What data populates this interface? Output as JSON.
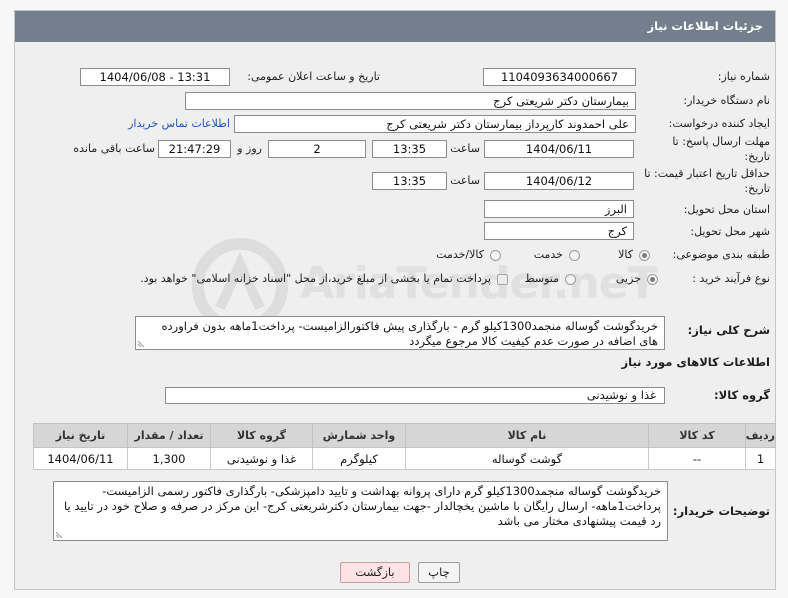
{
  "header": {
    "title": "جزئیات اطلاعات نیاز"
  },
  "watermark": {
    "text": "AriaTender.neT"
  },
  "colors": {
    "header_bg": "#737f8c",
    "link": "#1f56b3",
    "back_button_bg": "#fde3e6",
    "table_header_bg": "#d6d6d6"
  },
  "fields": {
    "need_number": {
      "label": "شماره نیاز:",
      "value": "1104093634000667"
    },
    "announce_datetime": {
      "label": "تاریخ و ساعت اعلان عمومی:",
      "value": "1404/06/08 - 13:31"
    },
    "buyer_org": {
      "label": "نام دستگاه خریدار:",
      "value": "بیمارستان دکتر شریعتی کرج"
    },
    "requester": {
      "label": "ایجاد کننده درخواست:",
      "value": "علی احمدوند کارپرداز بیمارستان دکتر شریعتی کرج",
      "contact_link": "اطلاعات تماس خریدار"
    },
    "reply_deadline": {
      "label_line1": "مهلت ارسال پاسخ: تا",
      "label_line2": "تاریخ:",
      "date": "1404/06/11",
      "time_label": "ساعت",
      "time": "13:35",
      "days": "2",
      "days_label": "روز و",
      "remaining_time": "21:47:29",
      "remaining_label": "ساعت باقی مانده"
    },
    "price_validity": {
      "label_line1": "حداقل تاریخ اعتبار قیمت: تا",
      "label_line2": "تاریخ:",
      "date": "1404/06/12",
      "time_label": "ساعت",
      "time": "13:35"
    },
    "delivery_province": {
      "label": "استان محل تحویل:",
      "value": "البرز"
    },
    "delivery_city": {
      "label": "شهر محل تحویل:",
      "value": "کرج"
    },
    "subject_category": {
      "label": "طبقه بندی موضوعی:",
      "options": [
        {
          "label": "کالا",
          "selected": true
        },
        {
          "label": "خدمت",
          "selected": false
        },
        {
          "label": "کالا/خدمت",
          "selected": false
        }
      ]
    },
    "purchase_process": {
      "label": "نوع فرآیند خرید :",
      "options": [
        {
          "label": "جزیی",
          "selected": true
        },
        {
          "label": "متوسط",
          "selected": false
        }
      ],
      "treasury_option": {
        "label": "پرداخت تمام یا بخشی از مبلغ خرید،از محل \"اسناد خزانه اسلامی\" خواهد بود.",
        "checked": false
      }
    },
    "general_description": {
      "label": "شرح کلی نیاز:",
      "value": "خریدگوشت گوساله منجمد1300کیلو گرم - بارگذاری پیش فاکتورالزامیست- پرداخت1ماهه بدون فراورده های اضافه در صورت عدم کیفیت کالا مرجوع میگردد"
    }
  },
  "items": {
    "section_title": "اطلاعات کالاهای مورد نیاز",
    "group_label": "گروه کالا:",
    "group_value": "غذا و نوشیدنی",
    "columns": [
      "ردیف",
      "کد کالا",
      "نام کالا",
      "واحد شمارش",
      "گروه کالا",
      "تعداد / مقدار",
      "تاریخ نیاز"
    ],
    "rows": [
      [
        "1",
        "--",
        "گوشت گوساله",
        "کیلوگرم",
        "غذا و نوشیدنی",
        "1,300",
        "1404/06/11"
      ]
    ]
  },
  "buyer_notes": {
    "label": "توضیحات خریدار:",
    "value": "خریدگوشت گوساله منجمد1300کیلو گرم دارای پروانه بهداشت و تایید دامپزشکی- بارگذاری  فاکتور رسمی الزامیست- پرداخت1ماهه- ارسال رایگان با ماشین یخچالدار -جهت بیمارستان دکترشریعتی کرج- این مرکز در صرفه و صلاح خود در تایید یا رد قیمت پیشنهادی مختار می باشد"
  },
  "buttons": {
    "print": "چاپ",
    "back": "بازگشت"
  }
}
